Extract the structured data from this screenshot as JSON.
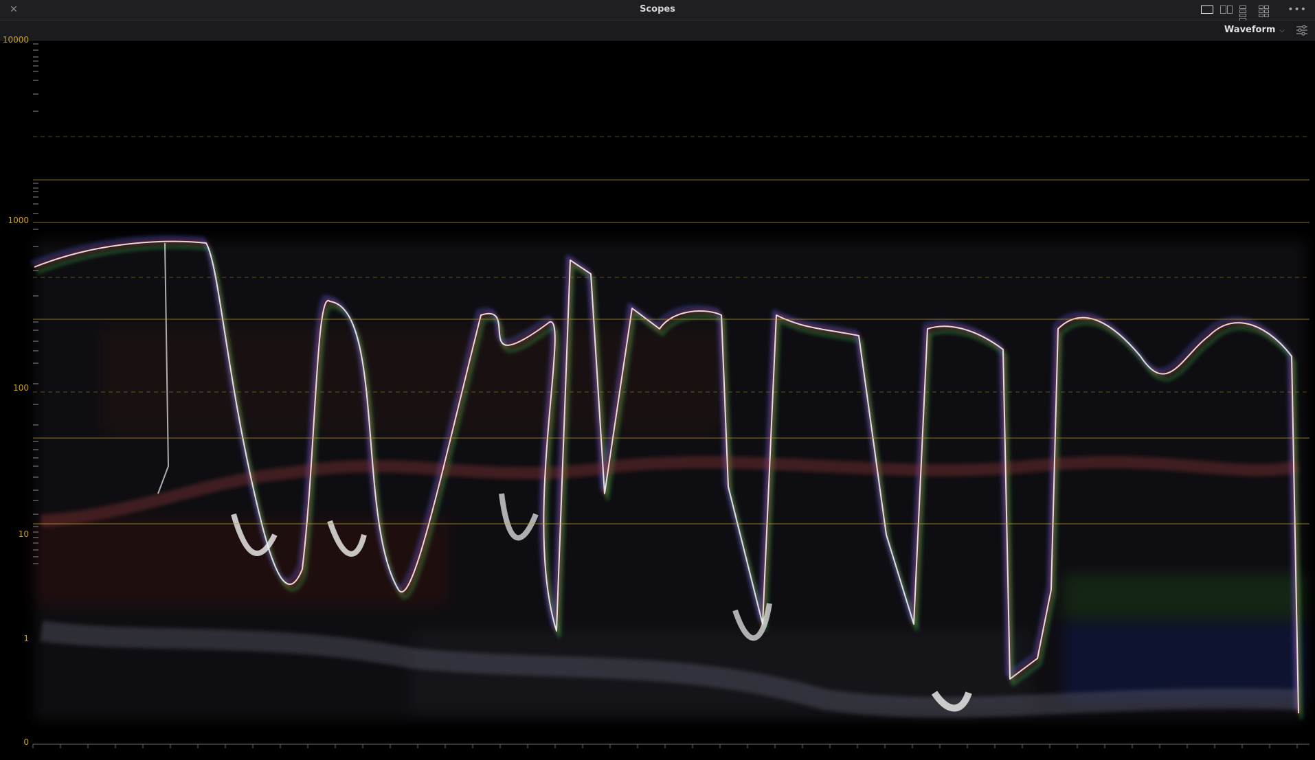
{
  "window": {
    "title": "Scopes",
    "close_icon": "close-icon",
    "more_icon": "more-options-icon"
  },
  "layout_buttons": [
    {
      "name": "single-view",
      "icon": "single-layout-icon",
      "active": true
    },
    {
      "name": "dual-view",
      "icon": "dual-layout-icon",
      "active": false
    },
    {
      "name": "quad-view",
      "icon": "quad-layout-icon",
      "active": false
    },
    {
      "name": "six-view",
      "icon": "six-layout-icon",
      "active": false
    }
  ],
  "toolbar": {
    "mode_label": "Waveform",
    "dropdown_icon": "chevron-down-icon",
    "settings_icon": "settings-sliders-icon"
  },
  "scale": {
    "labels": [
      "10000",
      "1000",
      "100",
      "10",
      "1",
      "0"
    ],
    "type": "log-nits",
    "solid_lines": [
      10000,
      1000,
      500,
      100,
      10,
      1
    ],
    "dashed_lines": [
      2000,
      200,
      25
    ],
    "accent": "#c9a227"
  }
}
